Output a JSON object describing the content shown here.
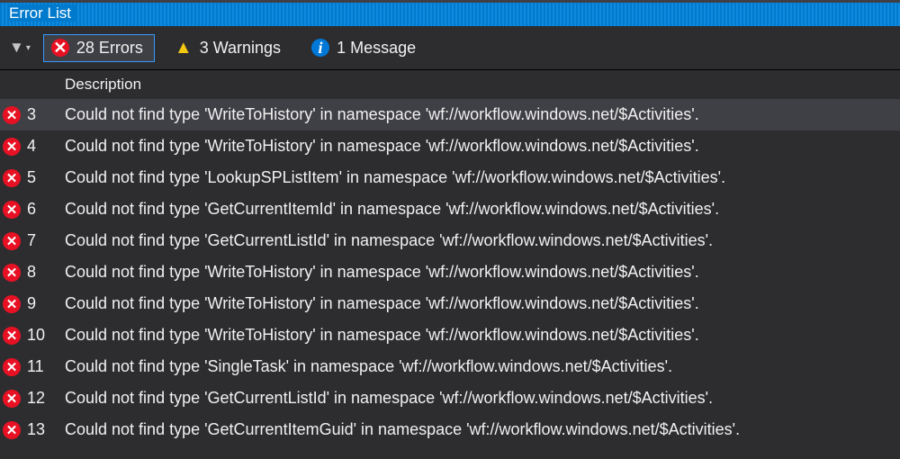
{
  "panel": {
    "title": "Error List"
  },
  "toolbar": {
    "errors_label": "28 Errors",
    "warnings_label": "3 Warnings",
    "messages_label": "1 Message"
  },
  "columns": {
    "description": "Description"
  },
  "rows": [
    {
      "n": "3",
      "desc": "Could not find type 'WriteToHistory' in namespace 'wf://workflow.windows.net/$Activities'.",
      "selected": true
    },
    {
      "n": "4",
      "desc": "Could not find type 'WriteToHistory' in namespace 'wf://workflow.windows.net/$Activities'."
    },
    {
      "n": "5",
      "desc": "Could not find type 'LookupSPListItem' in namespace 'wf://workflow.windows.net/$Activities'."
    },
    {
      "n": "6",
      "desc": "Could not find type 'GetCurrentItemId' in namespace 'wf://workflow.windows.net/$Activities'."
    },
    {
      "n": "7",
      "desc": "Could not find type 'GetCurrentListId' in namespace 'wf://workflow.windows.net/$Activities'."
    },
    {
      "n": "8",
      "desc": "Could not find type 'WriteToHistory' in namespace 'wf://workflow.windows.net/$Activities'."
    },
    {
      "n": "9",
      "desc": "Could not find type 'WriteToHistory' in namespace 'wf://workflow.windows.net/$Activities'."
    },
    {
      "n": "10",
      "desc": "Could not find type 'WriteToHistory' in namespace 'wf://workflow.windows.net/$Activities'."
    },
    {
      "n": "11",
      "desc": "Could not find type 'SingleTask' in namespace 'wf://workflow.windows.net/$Activities'."
    },
    {
      "n": "12",
      "desc": "Could not find type 'GetCurrentListId' in namespace 'wf://workflow.windows.net/$Activities'."
    },
    {
      "n": "13",
      "desc": "Could not find type 'GetCurrentItemGuid' in namespace 'wf://workflow.windows.net/$Activities'."
    }
  ]
}
